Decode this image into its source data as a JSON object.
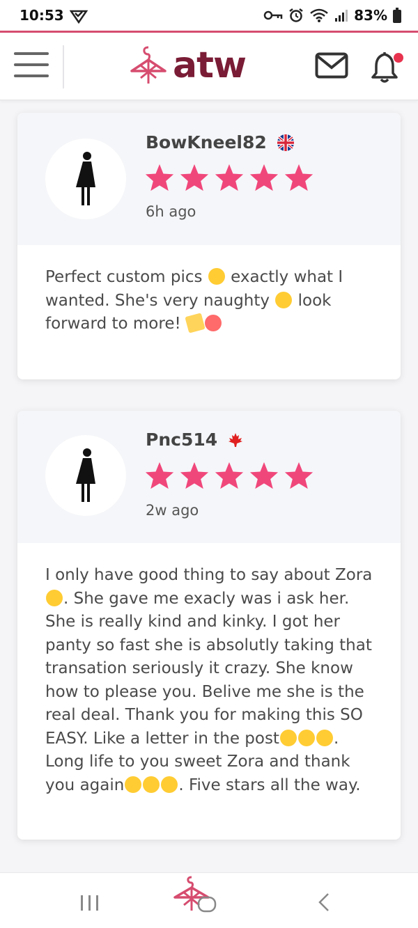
{
  "status_bar": {
    "time": "10:53",
    "battery_pct": "83%"
  },
  "header": {
    "logo_text": "atw",
    "icons": [
      "menu-icon",
      "hanger-logo-icon",
      "mail-icon",
      "bell-icon"
    ],
    "notification_dot_color": "#e8334f"
  },
  "colors": {
    "accent": "#d64c6f",
    "star": "#f0477b",
    "logo_text": "#7a1c35"
  },
  "reviews": [
    {
      "name": "BowKneel82",
      "flag": "uk-flag-icon",
      "rating": 5,
      "time_ago": "6h ago",
      "text_parts": [
        "Perfect custom pics ",
        " exactly what I wanted. She's very naughty ",
        " look forward to more! "
      ]
    },
    {
      "name": "Pnc514",
      "flag": "canada-flag-icon",
      "rating": 5,
      "time_ago": "2w ago",
      "text_parts": [
        "I only have good thing to say about Zora ",
        ". She gave me exacly was i ask her. She is really kind and kinky. I got her panty so fast she is absolutly taking that transation seriously it crazy. She know how to please you. Belive me she is the real deal. Thank you for making this SO EASY. Like a letter in the post",
        ". Long life to you sweet Zora and thank you again",
        ". Five stars all the way."
      ]
    }
  ],
  "bottom_nav": {
    "icons": [
      "recent-apps-icon",
      "home-icon",
      "back-icon"
    ]
  }
}
